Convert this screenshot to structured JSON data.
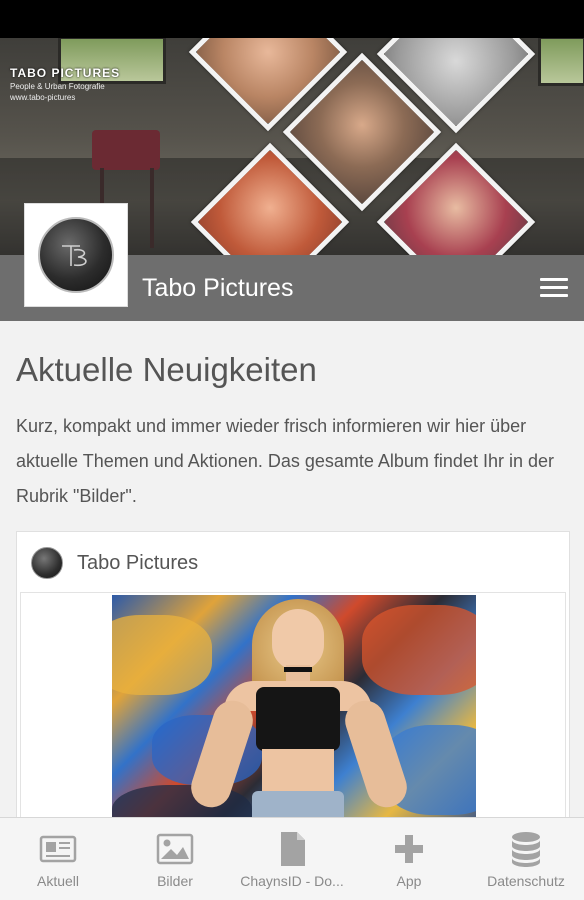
{
  "hero": {
    "brand_title": "TABO PICTURES",
    "brand_subtitle": "People & Urban Fotografie",
    "brand_url": "www.tabo-pictures"
  },
  "header": {
    "title": "Tabo Pictures",
    "menu_icon": "hamburger-menu-icon"
  },
  "main": {
    "headline": "Aktuelle Neuigkeiten",
    "intro": "Kurz, kompakt und immer wieder frisch informieren wir hier über aktuelle Themen und Aktionen. Das gesamte Album findet Ihr in der Rubrik \"Bilder\"."
  },
  "post": {
    "author": "Tabo Pictures"
  },
  "tabs": [
    {
      "label": "Aktuell",
      "icon": "newspaper-icon"
    },
    {
      "label": "Bilder",
      "icon": "image-icon"
    },
    {
      "label": "ChaynsID - Do...",
      "icon": "document-icon"
    },
    {
      "label": "App",
      "icon": "plus-icon"
    },
    {
      "label": "Datenschutz",
      "icon": "database-icon"
    }
  ],
  "colors": {
    "title_bar": "#6e6e6e",
    "background": "#f2f2f2",
    "tab_icon": "#a3a3a3",
    "text": "#555555"
  }
}
